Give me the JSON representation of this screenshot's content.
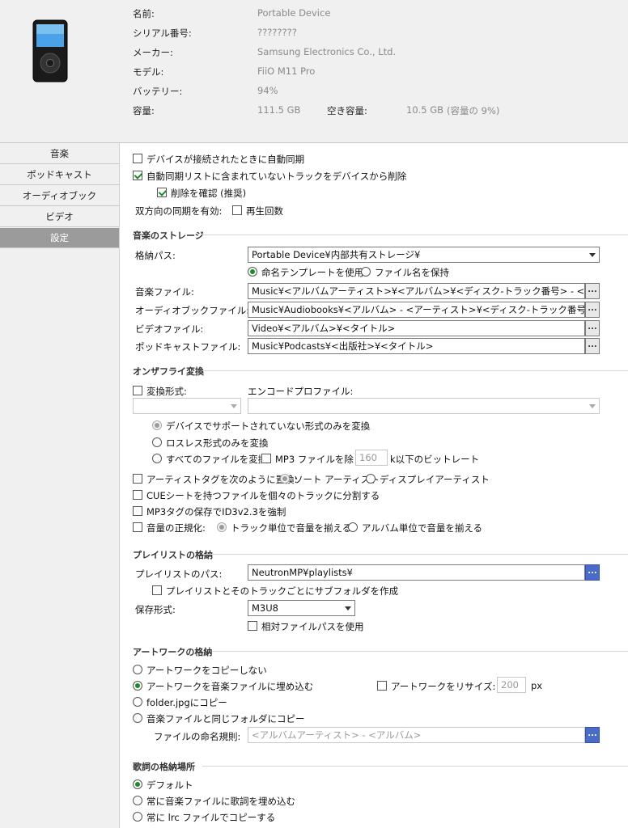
{
  "device": {
    "name_label": "名前:",
    "name_value": "Portable Device",
    "serial_label": "シリアル番号:",
    "serial_value": "????????",
    "maker_label": "メーカー:",
    "maker_value": "Samsung Electronics Co., Ltd.",
    "model_label": "モデル:",
    "model_value": "FiiO M11 Pro",
    "battery_label": "バッテリー:",
    "battery_value": "94%",
    "capacity_label": "容量:",
    "capacity_value": "111.5 GB",
    "free_label": "空き容量:",
    "free_value": "10.5 GB",
    "free_pct": "(容量の 9%)"
  },
  "sidebar": {
    "items": [
      {
        "label": "音楽"
      },
      {
        "label": "ポッドキャスト"
      },
      {
        "label": "オーディオブック"
      },
      {
        "label": "ビデオ"
      },
      {
        "label": "設定"
      }
    ],
    "active": "設定"
  },
  "sync": {
    "auto_sync": "デバイスが接続されたときに自動同期",
    "delete_not_in_list": "自動同期リストに含まれていないトラックをデバイスから削除",
    "confirm_delete": "削除を確認 (推奨)",
    "bidirectional_label": "双方向の同期を有効:",
    "play_count": "再生回数"
  },
  "storage": {
    "title": "音楽のストレージ",
    "path_label": "格納パス:",
    "path_value": "Portable Device¥内部共有ストレージ¥",
    "use_template": "命名テンプレートを使用",
    "keep_filename": "ファイル名を保持",
    "music_label": "音楽ファイル:",
    "music_value": "Music¥<アルバムアーティスト>¥<アルバム>¥<ディスク-トラック番号> - <タイトル>",
    "audiobook_label": "オーディオブックファイル:",
    "audiobook_value": "Music¥Audiobooks¥<アルバム> - <アーティスト>¥<ディスク-トラック番号> <タイトル>",
    "video_label": "ビデオファイル:",
    "video_value": "Video¥<アルバム>¥<タイトル>",
    "podcast_label": "ポッドキャストファイル:",
    "podcast_value": "Music¥Podcasts¥<出版社>¥<タイトル>",
    "dots": "..."
  },
  "convert": {
    "title": "オンザフライ変換",
    "format_label": "変換形式:",
    "encode_profile_label": "エンコードプロファイル:",
    "unsupported_only": "デバイスでサポートされていない形式のみを変換",
    "lossless_only": "ロスレス形式のみを変換",
    "all_files": "すべてのファイルを変換",
    "exclude_mp3": "MP3 ファイルを除く:",
    "bitrate_value": "160",
    "bitrate_suffix": "k以下のビットレート",
    "replace_artist": "アーティストタグを次のように置換:",
    "sort_artist": "ソート アーティスト",
    "display_artist": "ディスプレイアーティスト",
    "cue_split": "CUEシートを持つファイルを個々のトラックに分割する",
    "id3v23": "MP3タグの保存でID3v2.3を強制",
    "normalize": "音量の正規化:",
    "track_gain": "トラック単位で音量を揃える",
    "album_gain": "アルバム単位で音量を揃える"
  },
  "playlist": {
    "title": "プレイリストの格納",
    "path_label": "プレイリストのパス:",
    "path_value": "NeutronMP¥playlists¥",
    "subfolder": "プレイリストとそのトラックごとにサブフォルダを作成",
    "format_label": "保存形式:",
    "format_value": "M3U8",
    "relative_path": "相対ファイルパスを使用"
  },
  "artwork": {
    "title": "アートワークの格納",
    "no_copy": "アートワークをコピーしない",
    "embed": "アートワークを音楽ファイルに埋め込む",
    "resize": "アートワークをリサイズ:",
    "resize_value": "200",
    "px": "px",
    "folder_jpg": "folder.jpgにコピー",
    "same_folder": "音楽ファイルと同じフォルダにコピー",
    "naming_label": "ファイルの命名規則:",
    "naming_value": "<アルバムアーティスト> - <アルバム>"
  },
  "lyrics": {
    "title": "歌詞の格納場所",
    "default": "デフォルト",
    "embed": "常に音楽ファイルに歌詞を埋め込む",
    "lrc": "常に lrc ファイルでコピーする"
  },
  "colors": {
    "accent": "#1a8a2a",
    "active_nav": "#9b9b9b",
    "blue_button": "#4a6cc9"
  }
}
